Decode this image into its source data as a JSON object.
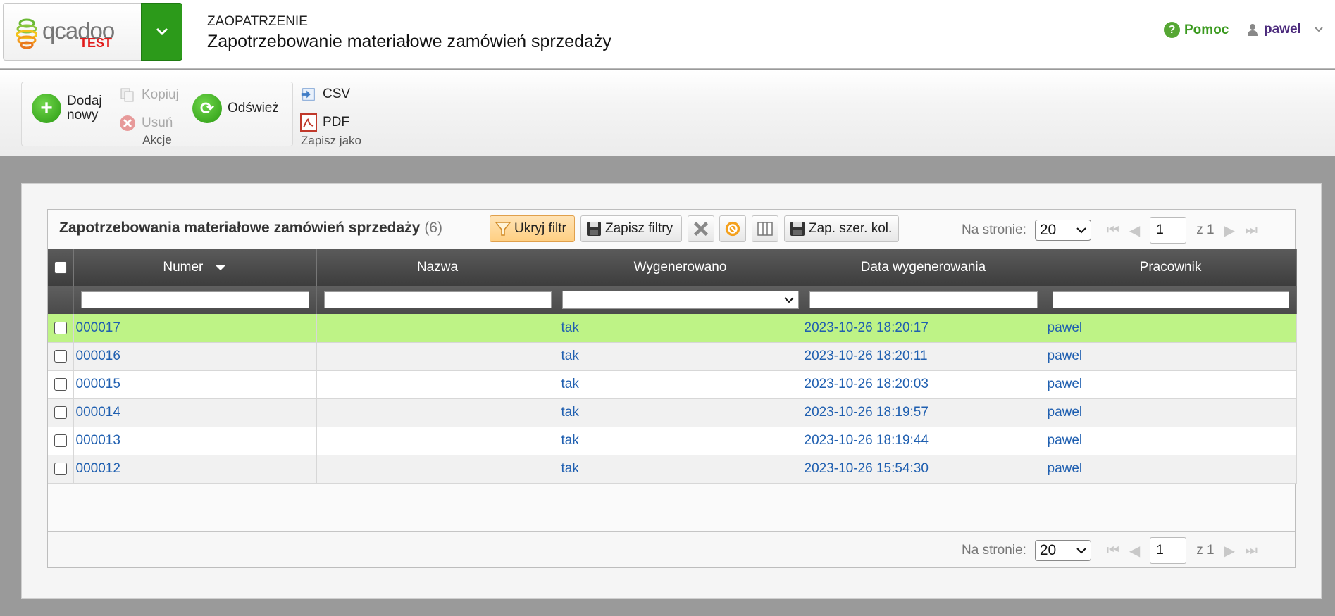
{
  "logo": {
    "name": "qcadoo",
    "badge": "TEST"
  },
  "breadcrumb": {
    "section": "ZAOPATRZENIE",
    "title": "Zapotrzebowanie materiałowe zamówień sprzedaży"
  },
  "header": {
    "help_label": "Pomoc",
    "user_label": "pawel"
  },
  "ribbon": {
    "actions_group_label": "Akcje",
    "add_new_line1": "Dodaj",
    "add_new_line2": "nowy",
    "copy_label": "Kopiuj",
    "delete_label": "Usuń",
    "refresh_label": "Odśwież",
    "export_group_label": "Zapisz jako",
    "csv_label": "CSV",
    "pdf_label": "PDF"
  },
  "grid": {
    "title": "Zapotrzebowania materiałowe zamówień sprzedaży",
    "count": "(6)",
    "toolbar": {
      "hide_filter": "Ukryj filtr",
      "save_filters": "Zapisz filtry",
      "save_column_widths": "Zap. szer. kol."
    },
    "pager": {
      "per_page_label": "Na stronie:",
      "per_page_value": "20",
      "current_page": "1",
      "of_pages": "z 1"
    },
    "columns": [
      "Numer",
      "Nazwa",
      "Wygenerowano",
      "Data wygenerowania",
      "Pracownik"
    ],
    "rows": [
      {
        "number": "000017",
        "name": "",
        "generated": "tak",
        "date": "2023-10-26 18:20:17",
        "worker": "pawel"
      },
      {
        "number": "000016",
        "name": "",
        "generated": "tak",
        "date": "2023-10-26 18:20:11",
        "worker": "pawel"
      },
      {
        "number": "000015",
        "name": "",
        "generated": "tak",
        "date": "2023-10-26 18:20:03",
        "worker": "pawel"
      },
      {
        "number": "000014",
        "name": "",
        "generated": "tak",
        "date": "2023-10-26 18:19:57",
        "worker": "pawel"
      },
      {
        "number": "000013",
        "name": "",
        "generated": "tak",
        "date": "2023-10-26 18:19:44",
        "worker": "pawel"
      },
      {
        "number": "000012",
        "name": "",
        "generated": "tak",
        "date": "2023-10-26 15:54:30",
        "worker": "pawel"
      }
    ]
  },
  "colors": {
    "brand_green": "#2c9a1a",
    "link_blue": "#1f5fb0",
    "selected_row": "#bef386",
    "logo_test_red": "#e21b1b"
  }
}
